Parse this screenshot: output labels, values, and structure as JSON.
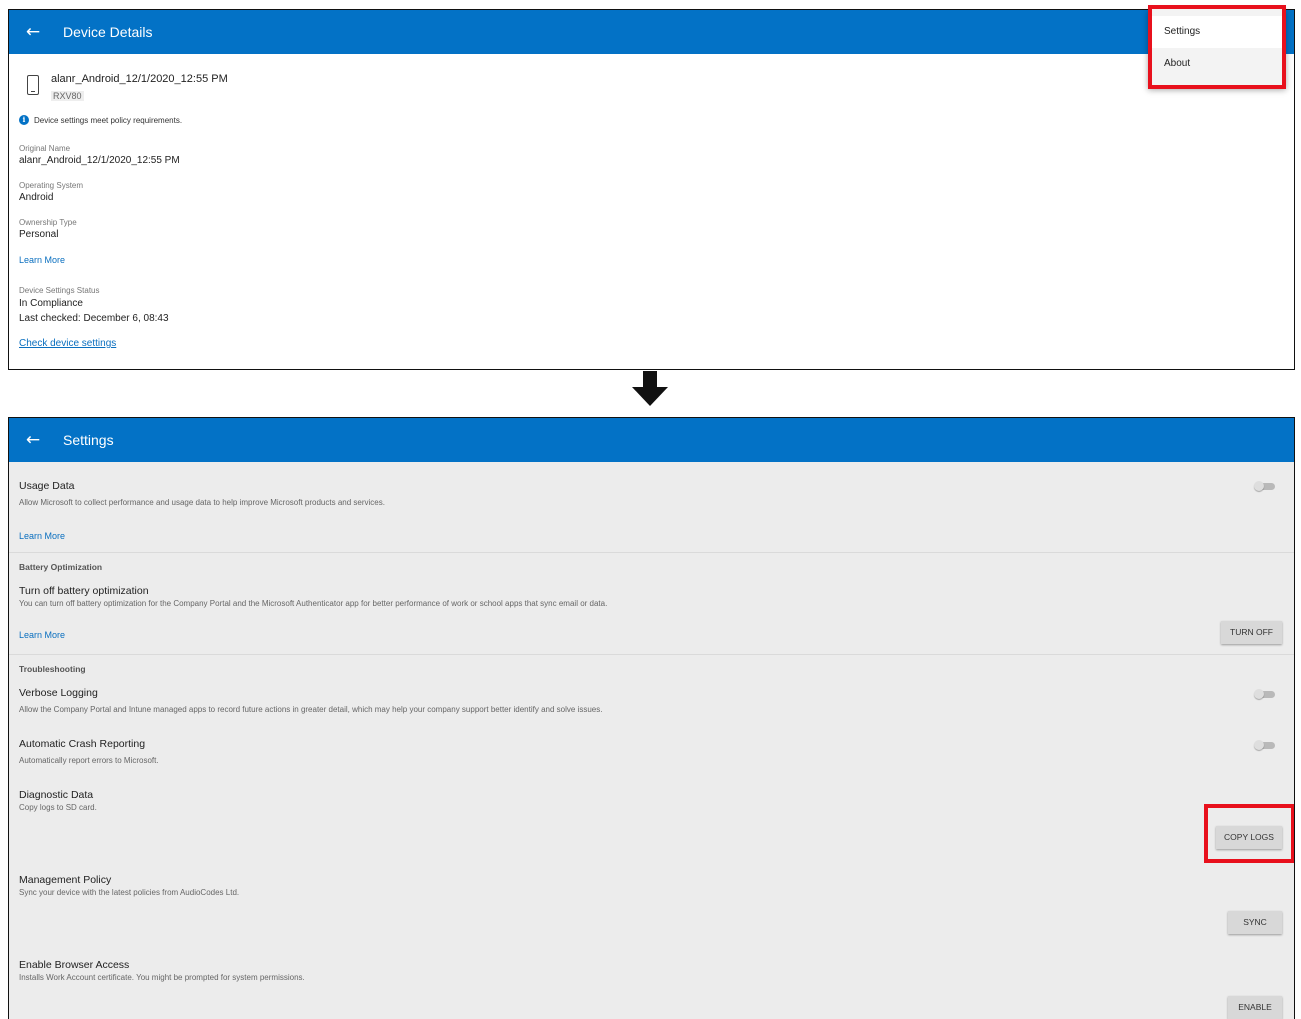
{
  "device_details": {
    "title": "Device Details",
    "back_glyph": "←",
    "device_name": "alanr_Android_12/1/2020_12:55 PM",
    "device_model": "RXV80",
    "status_message": "Device settings meet policy requirements.",
    "fields": [
      {
        "label": "Original Name",
        "value": "alanr_Android_12/1/2020_12:55 PM"
      },
      {
        "label": "Operating System",
        "value": "Android"
      },
      {
        "label": "Ownership Type",
        "value": "Personal"
      }
    ],
    "learn_more": "Learn More",
    "settings_status": {
      "label": "Device Settings Status",
      "value": "In Compliance",
      "last_checked": "Last checked: December 6, 08:43"
    },
    "check_link": "Check device settings"
  },
  "overflow_menu": {
    "items": [
      "Settings",
      "About"
    ]
  },
  "settings": {
    "title": "Settings",
    "back_glyph": "←",
    "usage_data": {
      "title": "Usage Data",
      "desc": "Allow Microsoft to collect performance and usage data to help improve Microsoft products and services.",
      "learn_more": "Learn More",
      "enabled": false
    },
    "battery": {
      "header": "Battery Optimization",
      "title": "Turn off battery optimization",
      "desc": "You can turn off battery optimization for the Company Portal and the Microsoft Authenticator app for better performance of work or school apps that sync email or data.",
      "learn_more": "Learn More",
      "button": "TURN OFF"
    },
    "troubleshooting": {
      "header": "Troubleshooting",
      "verbose": {
        "title": "Verbose Logging",
        "desc": "Allow the Company Portal and Intune managed apps to record future actions in greater detail, which may help your company support better identify and solve issues.",
        "enabled": false
      },
      "crash": {
        "title": "Automatic Crash Reporting",
        "desc": "Automatically report errors to Microsoft.",
        "enabled": false
      },
      "diagnostic": {
        "title": "Diagnostic Data",
        "desc": "Copy logs to SD card.",
        "button": "COPY LOGS"
      },
      "policy": {
        "title": "Management Policy",
        "desc": "Sync your device with the latest policies from AudioCodes Ltd.",
        "button": "SYNC"
      },
      "browser": {
        "title": "Enable Browser Access",
        "desc": "Installs Work Account certificate. You might be prompted for system permissions.",
        "button": "ENABLE"
      }
    }
  },
  "colors": {
    "appbar": "#0372c6",
    "link": "#0a6fbf",
    "highlight": "#e8101c",
    "settings_bg": "#ececec"
  }
}
